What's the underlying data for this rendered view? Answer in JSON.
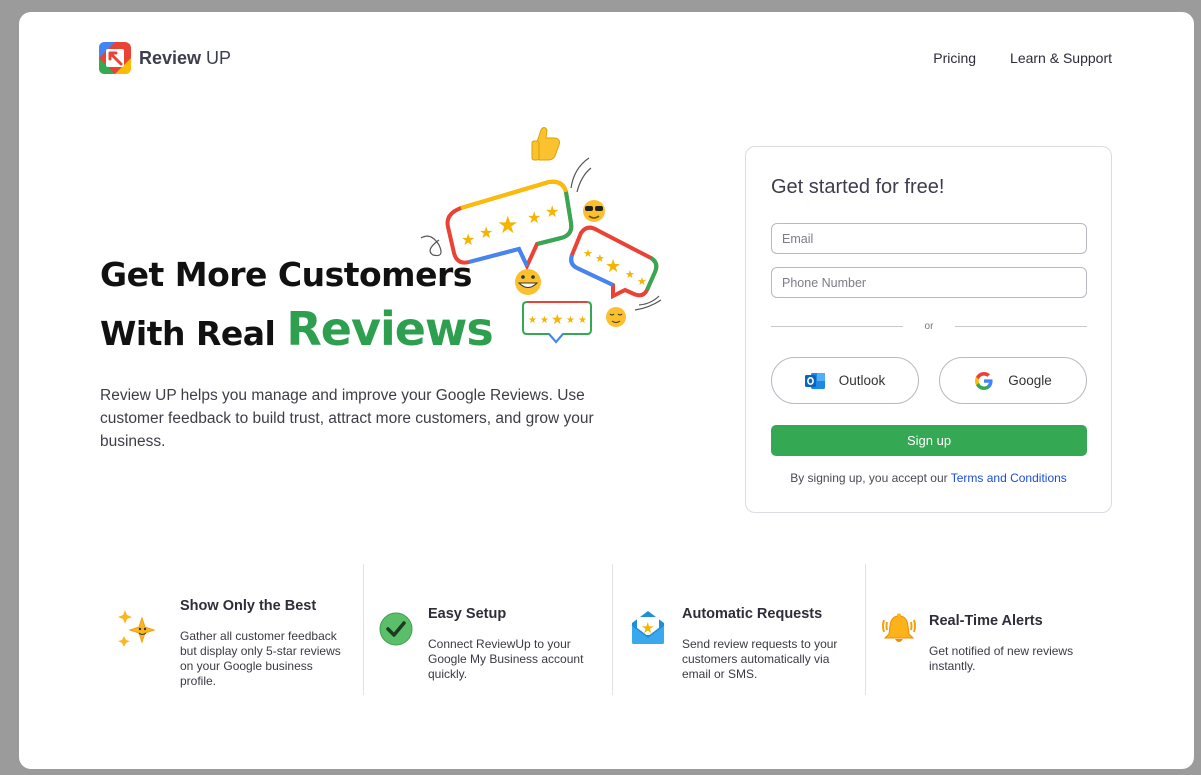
{
  "brand": {
    "name_bold": "Review",
    "name_thin": " UP"
  },
  "nav": {
    "items": [
      "Pricing",
      "Learn & Support"
    ]
  },
  "hero": {
    "line1": "Get More Customers",
    "line2_prefix": "With Real ",
    "line2_highlight": "Reviews",
    "description": "Review UP helps you manage and improve your Google Reviews. Use customer feedback to build trust, attract more customers, and grow your business."
  },
  "signup": {
    "title": "Get started for free!",
    "email_placeholder": "Email",
    "phone_placeholder": "Phone Number",
    "divider_text": "or",
    "outlook_label": "Outlook",
    "google_label": "Google",
    "submit_label": "Sign up",
    "terms_prefix": "By signing up, you accept our ",
    "terms_link": "Terms and Conditions"
  },
  "features": [
    {
      "title": "Show Only the Best",
      "description": "Gather all customer feedback but display only 5-star reviews on your Google business profile.",
      "icon": "sparkle-star-icon"
    },
    {
      "title": "Easy Setup",
      "description": "Connect ReviewUp to your Google My Business account quickly.",
      "icon": "check-circle-icon"
    },
    {
      "title": "Automatic Requests",
      "description": "Send review requests to your customers automatically via email or SMS.",
      "icon": "envelope-star-icon"
    },
    {
      "title": "Real-Time Alerts",
      "description": "Get notified of new reviews instantly.",
      "icon": "bell-icon"
    }
  ],
  "colors": {
    "accent_green": "#34a853",
    "link_blue": "#1b4fd8",
    "star_yellow": "#f4b400",
    "google_red": "#ea4335",
    "google_blue": "#4285f4"
  }
}
